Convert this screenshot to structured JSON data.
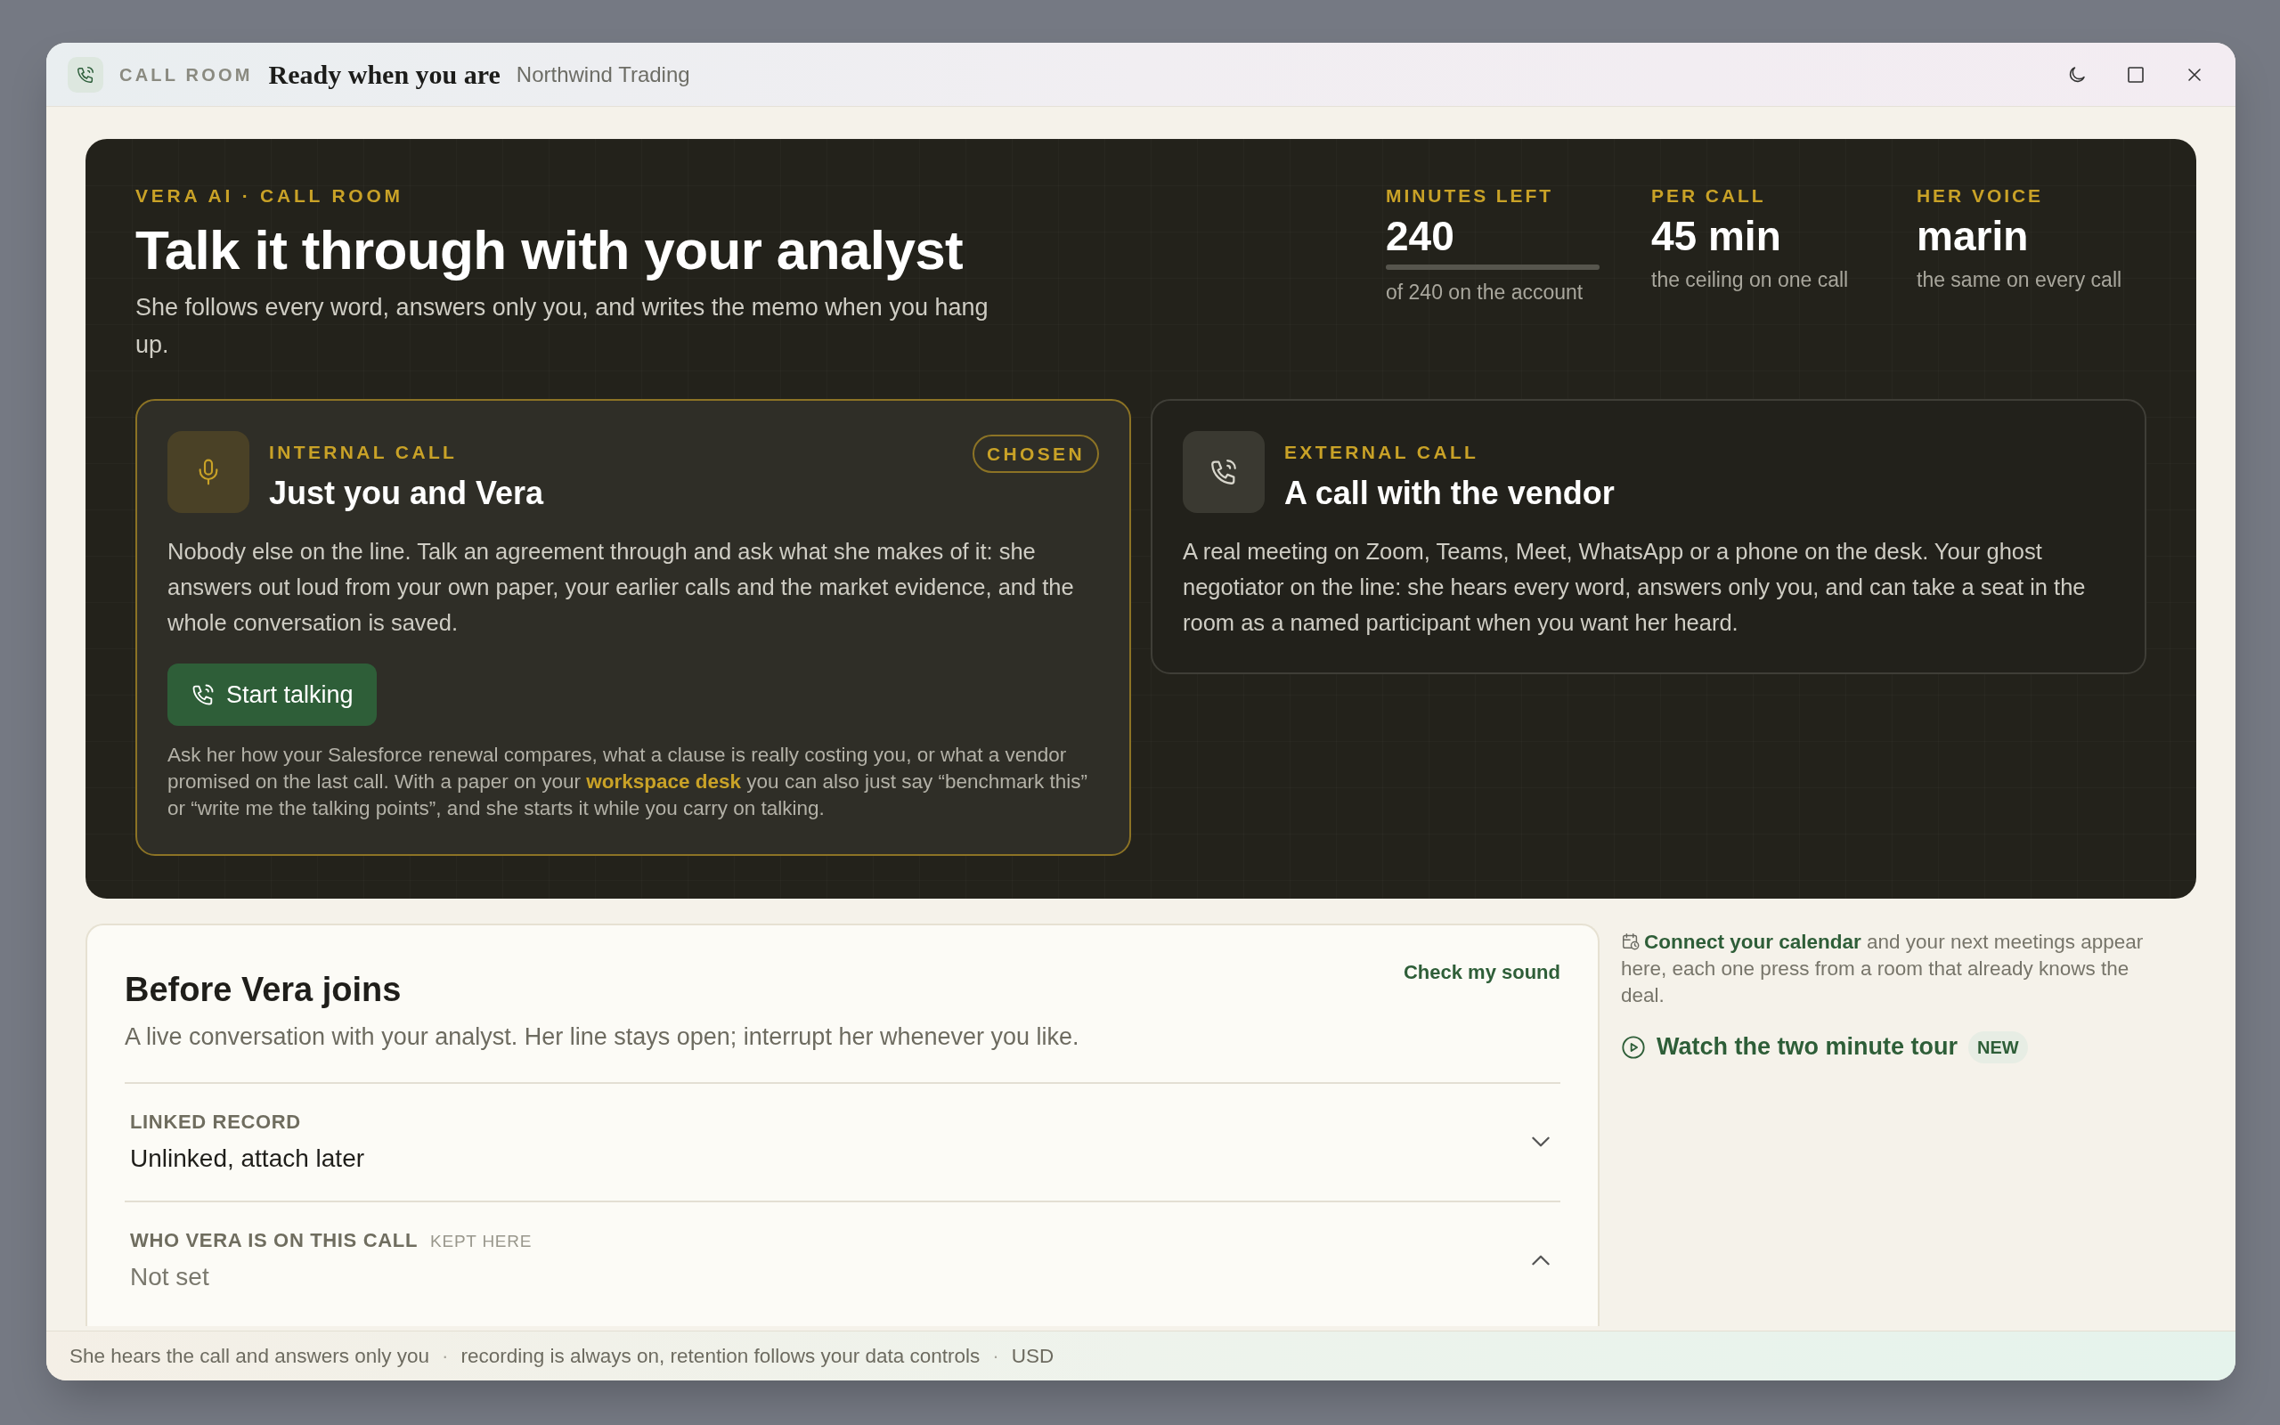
{
  "window": {
    "eyebrow": "CALL ROOM",
    "title": "Ready when you are",
    "subtitle": "Northwind Trading"
  },
  "hero": {
    "eyebrow": "VERA AI · CALL ROOM",
    "title": "Talk it through with your analyst",
    "subtitle": "She follows every word, answers only you, and writes the memo when you hang up.",
    "stats": [
      {
        "label": "MINUTES LEFT",
        "value": "240",
        "note": "of 240 on the account",
        "level": 1
      },
      {
        "label": "PER CALL",
        "value": "45 min",
        "note": "the ceiling on one call"
      },
      {
        "label": "HER VOICE",
        "value": "marin",
        "note": "the same on every call"
      }
    ],
    "modes": [
      {
        "kind": "internal",
        "eyebrow": "INTERNAL CALL",
        "title": "Just you and Vera",
        "selected": true,
        "badge": "CHOSEN",
        "body": "Nobody else on the line. Talk an agreement through and ask what she makes of it: she answers out loud from your own paper, your earlier calls and the market evidence, and the whole conversation is saved.",
        "button": "Start talking",
        "hint_before": "Ask her how your Salesforce renewal compares, what a clause is really costing you, or what a vendor promised on the last call. With a paper on your",
        "hint_link": "workspace desk",
        "hint_after": "you can also just say “benchmark this” or “write me the talking points”, and she starts it while you carry on talking."
      },
      {
        "kind": "external",
        "eyebrow": "EXTERNAL CALL",
        "title": "A call with the vendor",
        "selected": false,
        "body": "A real meeting on Zoom, Teams, Meet, WhatsApp or a phone on the desk. Your ghost negotiator on the line: she hears every word, answers only you, and can take a seat in the room as a named participant when you want her heard."
      }
    ]
  },
  "setup": {
    "title": "Before Vera joins",
    "action": "Check my sound",
    "subtitle": "A live conversation with your analyst. Her line stays open; interrupt her whenever you like.",
    "fields": [
      {
        "label": "LINKED RECORD",
        "value": "Unlinked, attach later",
        "empty": false,
        "expanded": false
      },
      {
        "label": "WHO VERA IS ON THIS CALL",
        "tag": "KEPT HERE",
        "value": "Not set",
        "empty": true,
        "expanded": true
      }
    ]
  },
  "aside": {
    "calendar_link": "Connect your calendar",
    "calendar_text": "and your next meetings appear here, each one press from a room that already knows the deal.",
    "tour": "Watch the two minute tour",
    "tour_badge": "NEW"
  },
  "status_separator": "·",
  "status_bar": [
    "She hears the call and answers only you",
    "recording is always on, retention follows your data controls",
    "USD"
  ]
}
